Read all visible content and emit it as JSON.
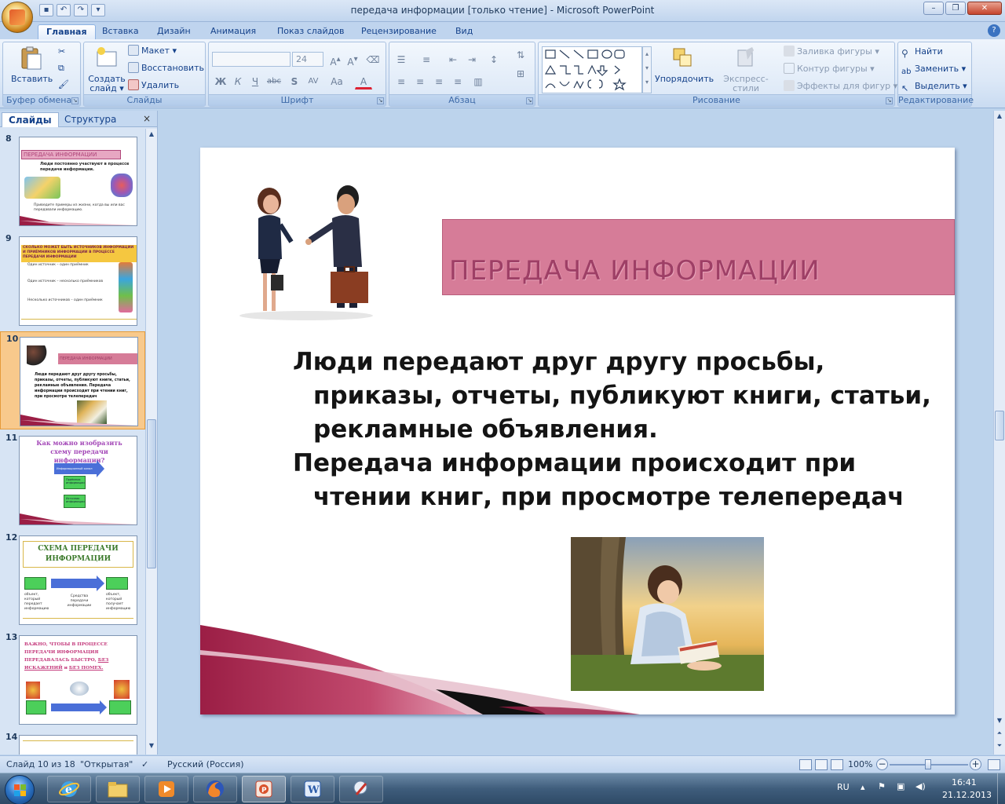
{
  "window": {
    "title": "передача информации  [только чтение] - Microsoft PowerPoint"
  },
  "tabs": [
    "Главная",
    "Вставка",
    "Дизайн",
    "Анимация",
    "Показ слайдов",
    "Рецензирование",
    "Вид"
  ],
  "ribbon": {
    "clipboard": {
      "label": "Буфер обмена",
      "paste": "Вставить"
    },
    "slides": {
      "label": "Слайды",
      "new_slide_line1": "Создать",
      "new_slide_line2": "слайд ▾",
      "layout": "Макет ▾",
      "reset": "Восстановить",
      "delete": "Удалить"
    },
    "font": {
      "label": "Шрифт",
      "size": "24",
      "bold": "Ж",
      "italic": "К",
      "underline": "Ч",
      "strike": "abc",
      "shadow": "S",
      "spacing": "AV",
      "case": "Aa",
      "color": "A"
    },
    "paragraph": {
      "label": "Абзац"
    },
    "drawing": {
      "label": "Рисование",
      "arrange": "Упорядочить",
      "quick_styles": "Экспресс-стили",
      "fill": "Заливка фигуры ▾",
      "outline": "Контур фигуры ▾",
      "effects": "Эффекты для фигур ▾"
    },
    "editing": {
      "label": "Редактирование",
      "find": "Найти",
      "replace": "Заменить ▾",
      "select": "Выделить ▾"
    }
  },
  "pane": {
    "tab_slides": "Слайды",
    "tab_outline": "Структура",
    "close": "×",
    "thumbs": [
      {
        "num": "8",
        "title": "ПЕРЕДАЧА ИНФОРМАЦИИ",
        "text": "Люди постоянно участвуют в процессе передачи информации.",
        "caption": "Приведите примеры из жизни, когда вы или вас передавали информацию."
      },
      {
        "num": "9",
        "title": "СКОЛЬКО МОЖЕТ БЫТЬ ИСТОЧНИКОВ ИНФОРМАЦИИ И ПРИЁМНИКОВ ИНФОРМАЦИИ В ПРОЦЕССЕ ПЕРЕДАЧИ ИНФОРМАЦИИ",
        "items": [
          "Один источник – один приёмник",
          "Один источник – несколько приёмников",
          "Несколько источников – один приёмник"
        ]
      },
      {
        "num": "10",
        "title": "ПЕРЕДАЧА ИНФОРМАЦИИ",
        "text": "Люди передают друг другу просьбы, приказы, отчеты, публикуют книги, статьи, рекламные объявления. Передача информации происходит при чтении книг, при просмотре телепередач"
      },
      {
        "num": "11",
        "title": "Как можно изобразить схему передачи информации?",
        "box1": "Информационный канал",
        "box2": "Приёмник информации",
        "box3": "Источник информации"
      },
      {
        "num": "12",
        "title": "СХЕМА ПЕРЕДАЧИ ИНФОРМАЦИИ",
        "col1": "объект, который передает информацию",
        "col2": "Средства передачи информации",
        "col3": "объект, который получает информацию"
      },
      {
        "num": "13",
        "title_a": "ВАЖНО, ЧТОБЫ В ПРОЦЕССЕ ПЕРЕДАЧИ ИНФОРМАЦИЯ ПЕРЕДАВАЛАСЬ БЫСТРО,",
        "title_b": "БЕЗ ИСКАЖЕНИЙ",
        "title_c": "и",
        "title_d": "БЕЗ ПОМЕХ."
      },
      {
        "num": "14"
      }
    ]
  },
  "slide": {
    "title": "ПЕРЕДАЧА ИНФОРМАЦИИ",
    "para1": "Люди передают друг другу просьбы, приказы, отчеты, публикуют книги, статьи, рекламные объявления.",
    "para2": "Передача информации происходит при чтении книг, при просмотре телепередач"
  },
  "status": {
    "slide_counter": "Слайд 10 из 18",
    "theme": "\"Открытая\"",
    "language": "Русский (Россия)",
    "zoom": "100%"
  },
  "taskbar": {
    "lang": "RU",
    "time": "16:41",
    "date": "21.12.2013"
  },
  "colors": {
    "banner": "#d67c98",
    "banner_text": "#9e3f66",
    "accent_wave": "#9b1e45",
    "selected_thumb": "#f8c98c"
  }
}
